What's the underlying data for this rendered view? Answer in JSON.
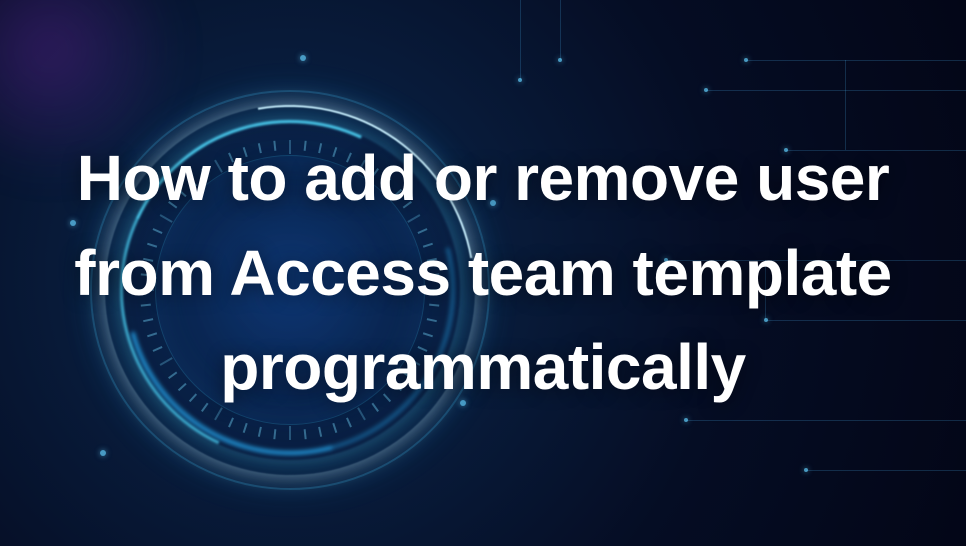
{
  "heading": "How to add or remove user from Access team template programmatically"
}
